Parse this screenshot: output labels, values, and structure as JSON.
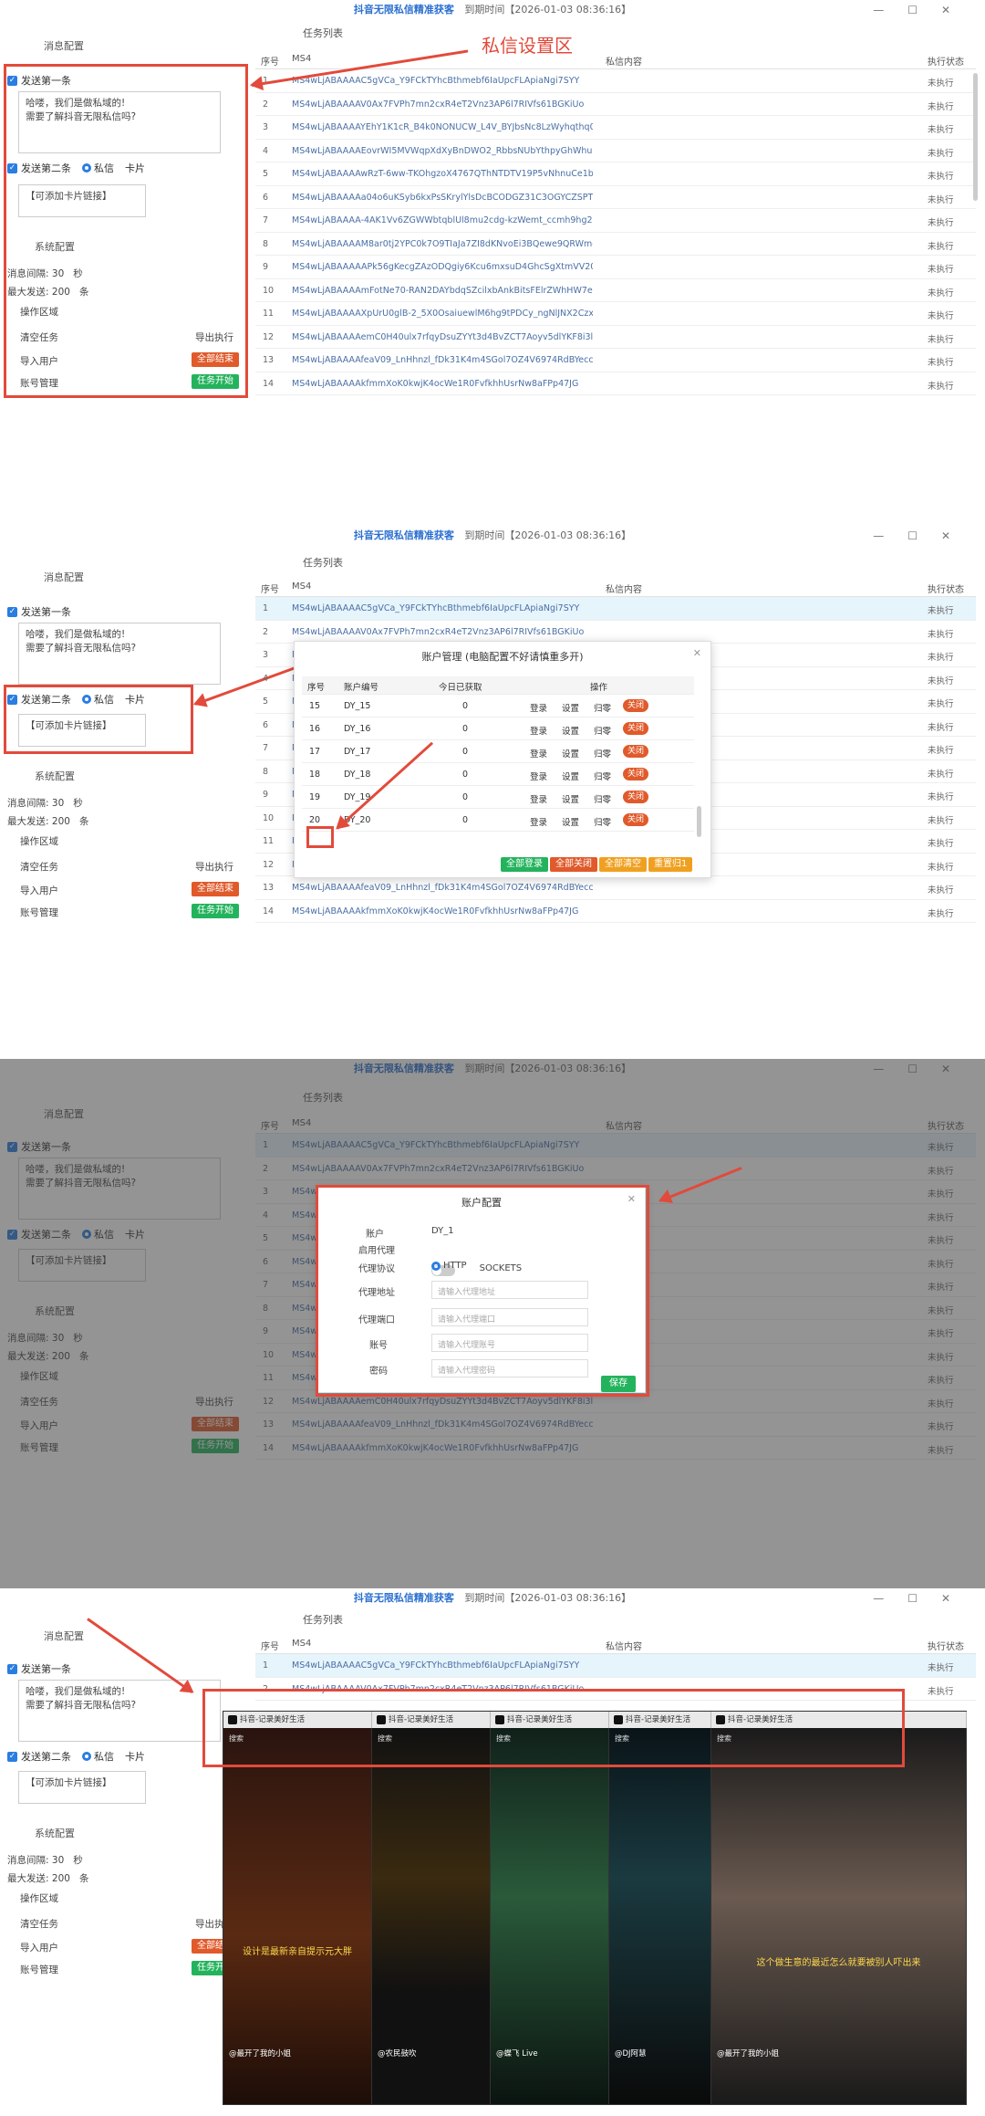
{
  "app": {
    "title": "抖音无限私信精准获客",
    "expiry": "到期时间【2026-01-03 08:36:16】"
  },
  "annotation": {
    "label": "私信设置区"
  },
  "left": {
    "msg_config": "消息配置",
    "send_first": "发送第一条",
    "first_text": "哈喽，我们是做私域的!\n需要了解抖音无限私信吗?",
    "send_second": "发送第二条",
    "radio_private": "私信",
    "radio_card": "卡片",
    "card_text": "【可添加卡片链接】",
    "sys_config": "系统配置",
    "interval_label": "消息间隔:",
    "interval_value": "30",
    "interval_unit": "秒",
    "max_label": "最大发送:",
    "max_value": "200",
    "max_unit": "条",
    "op_area": "操作区域",
    "clear_task": "清空任务",
    "import_exec": "导出执行",
    "import_users": "导入用户",
    "stop_all": "全部结束",
    "account_mgmt": "账号管理",
    "start_task": "任务开始"
  },
  "task_list": {
    "title": "任务列表",
    "headers": [
      "序号",
      "MS4",
      "私信内容",
      "执行状态"
    ],
    "rows": [
      {
        "no": "1",
        "ms": "MS4wLjABAAAAC5gVCa_Y9FCkTYhcBthmebf6IaUpcFLApiaNgi7SYY",
        "status": "未执行"
      },
      {
        "no": "2",
        "ms": "MS4wLjABAAAAV0Ax7FVPh7mn2cxR4eT2Vnz3AP6l7RIVfs61BGKiUo",
        "status": "未执行"
      },
      {
        "no": "3",
        "ms": "MS4wLjABAAAAYEhY1K1cR_B4k0NONUCW_L4V_BYJbsNc8LzWyhqthq0e7cmu20C8_...",
        "status": "未执行"
      },
      {
        "no": "4",
        "ms": "MS4wLjABAAAAEovrWI5MVWqpXdXyBnDWO2_RbbsNUbYthpyGhWhuo",
        "status": "未执行"
      },
      {
        "no": "5",
        "ms": "MS4wLjABAAAAwRzT-6ww-TKOhgzoX4767QThNTDTV19P5vNhnuCe1bN7n5m3P8aSP...",
        "status": "未执行"
      },
      {
        "no": "6",
        "ms": "MS4wLjABAAAAa04o6uKSyb6kxPsSKrylYlsDcBCODGZ31C3OGYCZSPT64WhrFcn4rxTF...",
        "status": "未执行"
      },
      {
        "no": "7",
        "ms": "MS4wLjABAAAA-4AK1Vv6ZGWWbtqblUl8mu2cdg-kzWemt_ccmh9hg2BKK_lfo7ZWzpo...",
        "status": "未执行"
      },
      {
        "no": "8",
        "ms": "MS4wLjABAAAAM8ar0tj2YPC0k7O9TIaJa7ZI8dKNvoEi3BQewe9QRWmcJZNTZWuO...",
        "status": "未执行"
      },
      {
        "no": "9",
        "ms": "MS4wLjABAAAAAPk56gKecgZAzODQgiy6Kcu6mxsuD4GhcSgXtmVV200Xpcu7Vu9F...",
        "status": "未执行"
      },
      {
        "no": "10",
        "ms": "MS4wLjABAAAAmFotNe70-RAN2DAYbdqSZcilxbAnkBitsFElrZWhHW7eUs",
        "status": "未执行"
      },
      {
        "no": "11",
        "ms": "MS4wLjABAAAAXpUrU0glB-2_5X0OsaiuewlM6hg9tPDCy_ngNlJNX2CzxjX7MGrEgWvLyl...",
        "status": "未执行"
      },
      {
        "no": "12",
        "ms": "MS4wLjABAAAAemC0H40ulx7rfqyDsuZYYt3d4BvZCT7Aoyv5dlYKF8i3lkg",
        "status": "未执行"
      },
      {
        "no": "13",
        "ms": "MS4wLjABAAAAfeaV09_LnHhnzl_fDk31K4m4SGol7OZ4V6974RdBYeccaGsCewpvFrwmEN...",
        "status": "未执行"
      },
      {
        "no": "14",
        "ms": "MS4wLjABAAAAkfmmXoK0kwjK4ocWe1R0FvfkhhUsrNw8aFPp47JG",
        "status": "未执行"
      }
    ]
  },
  "account_mgmt": {
    "title": "账户管理 (电脑配置不好请慎重多开)",
    "headers": [
      "序号",
      "账户编号",
      "今日已获取",
      "操作"
    ],
    "rows": [
      {
        "no": "15",
        "acc": "DY_15",
        "count": "0"
      },
      {
        "no": "16",
        "acc": "DY_16",
        "count": "0"
      },
      {
        "no": "17",
        "acc": "DY_17",
        "count": "0"
      },
      {
        "no": "18",
        "acc": "DY_18",
        "count": "0"
      },
      {
        "no": "19",
        "acc": "DY_19",
        "count": "0"
      },
      {
        "no": "20",
        "acc": "DY_20",
        "count": "0"
      }
    ],
    "op_login": "登录",
    "op_settings": "设置",
    "op_return": "归零",
    "op_close": "关闭",
    "btn_login_all": "全部登录",
    "btn_close_all": "全部关闭",
    "btn_clear_all": "全部清空",
    "btn_reset_all": "重置归1"
  },
  "account_config": {
    "title": "账户配置",
    "account_label": "账户",
    "account_value": "DY_1",
    "proxy_enable": "启用代理",
    "proxy_protocol": "代理协议",
    "http": "HTTP",
    "sockets": "SOCKETS",
    "proxy_addr": "代理地址",
    "proxy_addr_ph": "请输入代理地址",
    "proxy_port": "代理端口",
    "proxy_port_ph": "请输入代理端口",
    "account_no": "账号",
    "account_no_ph": "请输入代理账号",
    "password": "密码",
    "password_ph": "请输入代理密码",
    "save": "保存"
  },
  "browsers": {
    "tabs": [
      "抖音-记录美好生活",
      "抖音-记录美好生活",
      "抖音-记录美好生活",
      "抖音-记录美好生活",
      "抖音-记录美好生活"
    ],
    "search_ph": "搜索",
    "captions": [
      "设计是最新亲自提示元大胖",
      "",
      "",
      "",
      "这个做生意的最近怎么就要被别人吓出来"
    ],
    "users": [
      "@最开了我的小姐",
      "@农民鼓吹 ",
      "@蝶飞 Live",
      "@DJ阿慧",
      "@最开了我的小姐"
    ]
  },
  "colors": {
    "accent": "#2a7de1",
    "danger": "#e05a2b",
    "success": "#24b35d",
    "annotation": "#e24a3b"
  }
}
